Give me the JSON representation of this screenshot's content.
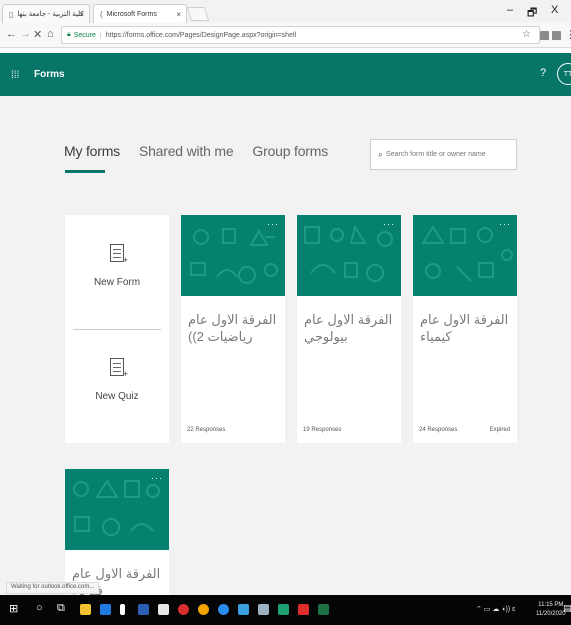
{
  "browser": {
    "tabs": [
      {
        "title": "كلية التربية - جامعة بنها"
      },
      {
        "title": "Microsoft Forms"
      }
    ],
    "window_controls": {
      "minimize": "–",
      "maximize": "🗗",
      "close": "X"
    },
    "address": {
      "secure_label": "Secure",
      "url": "https://forms.office.com/Pages/DesignPage.aspx?origin=shell"
    }
  },
  "app": {
    "brand": "Forms",
    "help": "?",
    "avatar_initials": "TT",
    "accent_color": "#077568"
  },
  "nav": {
    "tabs": [
      {
        "label": "My forms",
        "active": true
      },
      {
        "label": "Shared with me",
        "active": false
      },
      {
        "label": "Group forms",
        "active": false
      }
    ],
    "search_placeholder": "Search form title or owner name"
  },
  "create": {
    "new_form": "New Form",
    "new_quiz": "New Quiz"
  },
  "forms": [
    {
      "title": "الفرقة الاول عام رياضيات 2))",
      "responses": "22 Responses",
      "status": ""
    },
    {
      "title": "الفرقة الاول عام بيولوجي",
      "responses": "19 Responses",
      "status": ""
    },
    {
      "title": "الفرقة الاول عام كيمياء",
      "responses": "24 Responses",
      "status": "Expired"
    },
    {
      "title": "الفرقة الاول عام فيزياء",
      "responses": "",
      "status": ""
    }
  ],
  "status_bar": "Waiting for outlook.office.com...",
  "taskbar": {
    "time": "11:15 PM",
    "date": "11/20/2020"
  }
}
